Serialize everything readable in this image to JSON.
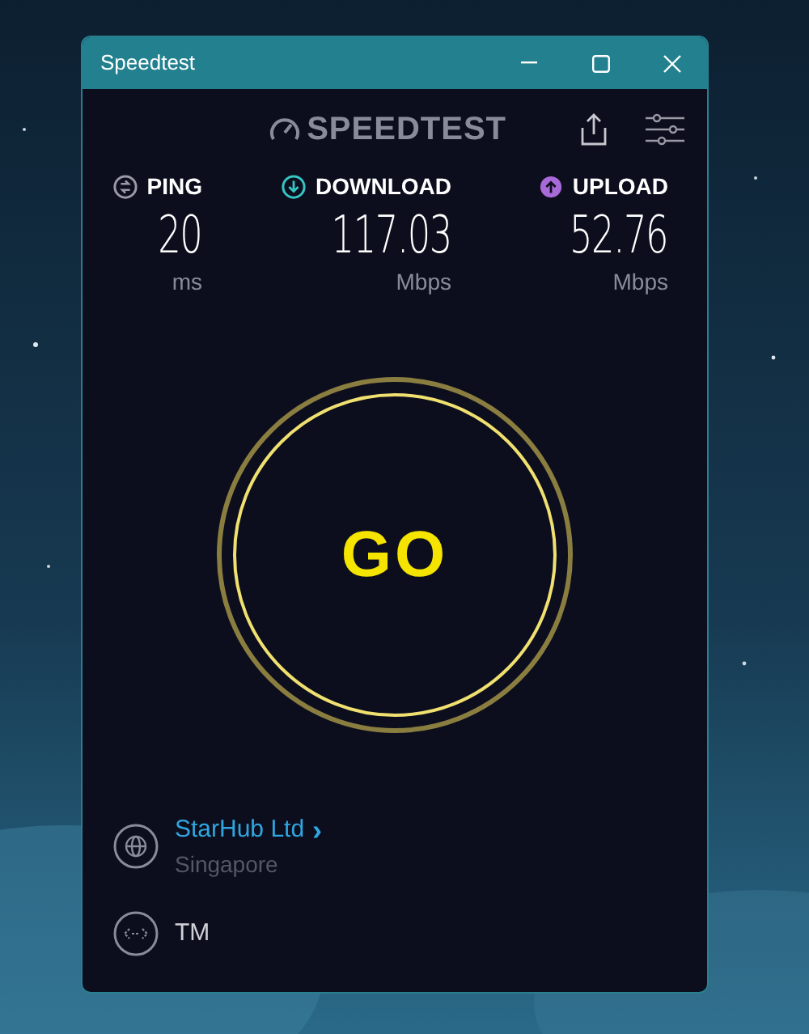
{
  "window": {
    "title": "Speedtest"
  },
  "logo": {
    "text": "SPEEDTEST"
  },
  "metrics": [
    {
      "kind": "ping",
      "label": "PING",
      "value": "20",
      "unit": "ms",
      "color": "#9a9aa6"
    },
    {
      "kind": "download",
      "label": "DOWNLOAD",
      "value": "117.03",
      "unit": "Mbps",
      "color": "#35c6c4"
    },
    {
      "kind": "upload",
      "label": "UPLOAD",
      "value": "52.76",
      "unit": "Mbps",
      "color": "#a86ad8"
    }
  ],
  "go_button": {
    "label": "GO"
  },
  "server": {
    "provider": "StarHub Ltd",
    "chevron": "›",
    "location": "Singapore"
  },
  "connection": {
    "name": "TM"
  }
}
